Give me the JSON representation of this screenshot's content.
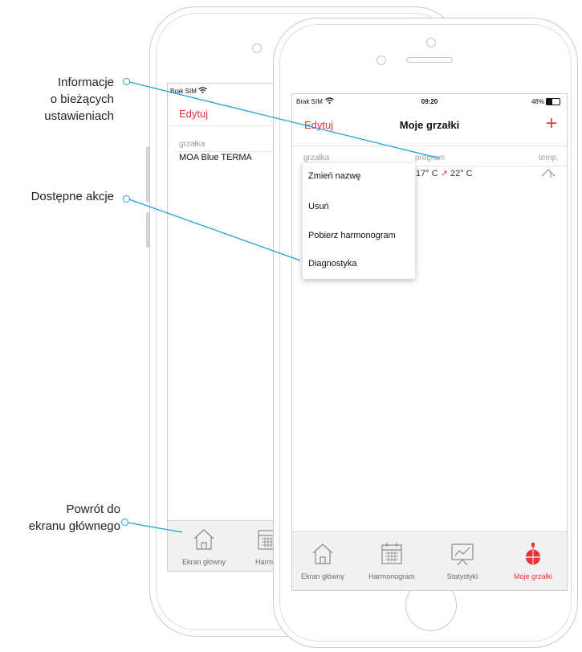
{
  "annotations": {
    "current_settings": [
      "Informacje",
      "o bieżących",
      "ustawieniach"
    ],
    "available_actions": "Dostępne akcje",
    "back_home": [
      "Powrót do",
      "ekranu głównego"
    ]
  },
  "accent_color": "#e8333a",
  "line_color": "#1aa3d9",
  "back_phone": {
    "carrier": "Brak SIM",
    "edit": "Edytuj",
    "column_heater": "grzałka",
    "heater_name": "MOA Blue TERMA",
    "tabs": [
      "Ekran główny",
      "Harmon"
    ]
  },
  "front_phone": {
    "carrier": "Brak SIM",
    "time": "09:20",
    "battery": "48%",
    "edit": "Edytuj",
    "title": "Moje grzałki",
    "add": "+",
    "columns": {
      "heater": "grzałka",
      "program": "program",
      "temp": "temp."
    },
    "program_from": "17° C",
    "program_arrow": "↗",
    "program_to": "22° C",
    "context_menu": [
      "Zmień nazwę",
      "Usuń",
      "Pobierz harmonogram",
      "Diagnostyka"
    ],
    "tabs": [
      {
        "label": "Ekran główny",
        "icon": "home-icon",
        "active": false
      },
      {
        "label": "Harmonogram",
        "icon": "calendar-icon",
        "active": false
      },
      {
        "label": "Statystyki",
        "icon": "statistics-icon",
        "active": false
      },
      {
        "label": "Moje grzałki",
        "icon": "heater-icon",
        "active": true
      }
    ]
  }
}
